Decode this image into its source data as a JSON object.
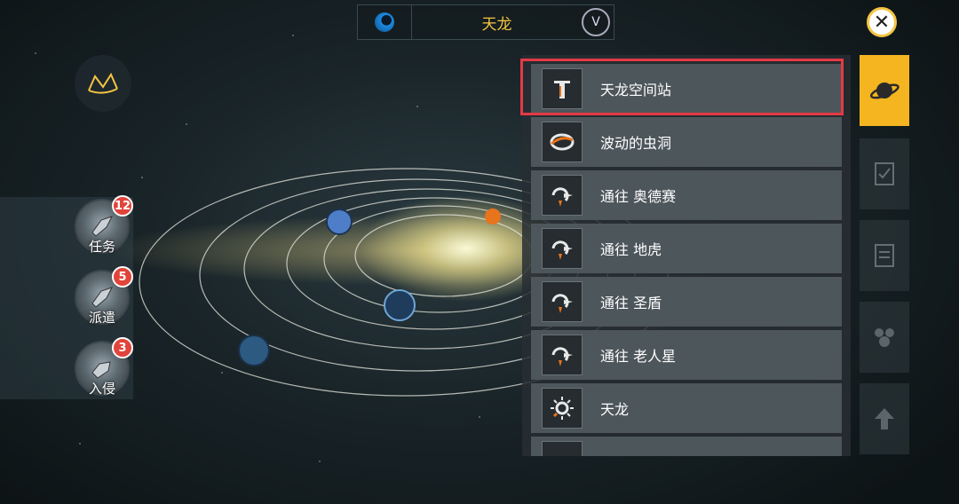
{
  "top": {
    "title": "天龙"
  },
  "list": {
    "items": [
      {
        "label": "天龙空间站",
        "icon": "space-station-icon"
      },
      {
        "label": "波动的虫洞",
        "icon": "wormhole-icon"
      },
      {
        "label": "通往 奥德赛",
        "icon": "jump-gate-icon"
      },
      {
        "label": "通往 地虎",
        "icon": "jump-gate-icon"
      },
      {
        "label": "通往 圣盾",
        "icon": "jump-gate-icon"
      },
      {
        "label": "通往 老人星",
        "icon": "jump-gate-icon"
      },
      {
        "label": "天龙",
        "icon": "star-icon"
      }
    ]
  },
  "missions": [
    {
      "label": "任务",
      "badge": "12"
    },
    {
      "label": "派遣",
      "badge": "5"
    },
    {
      "label": "入侵",
      "badge": "3"
    }
  ],
  "colors": {
    "accent": "#f5b520",
    "highlight": "#e53946",
    "badge": "#e0443a"
  }
}
